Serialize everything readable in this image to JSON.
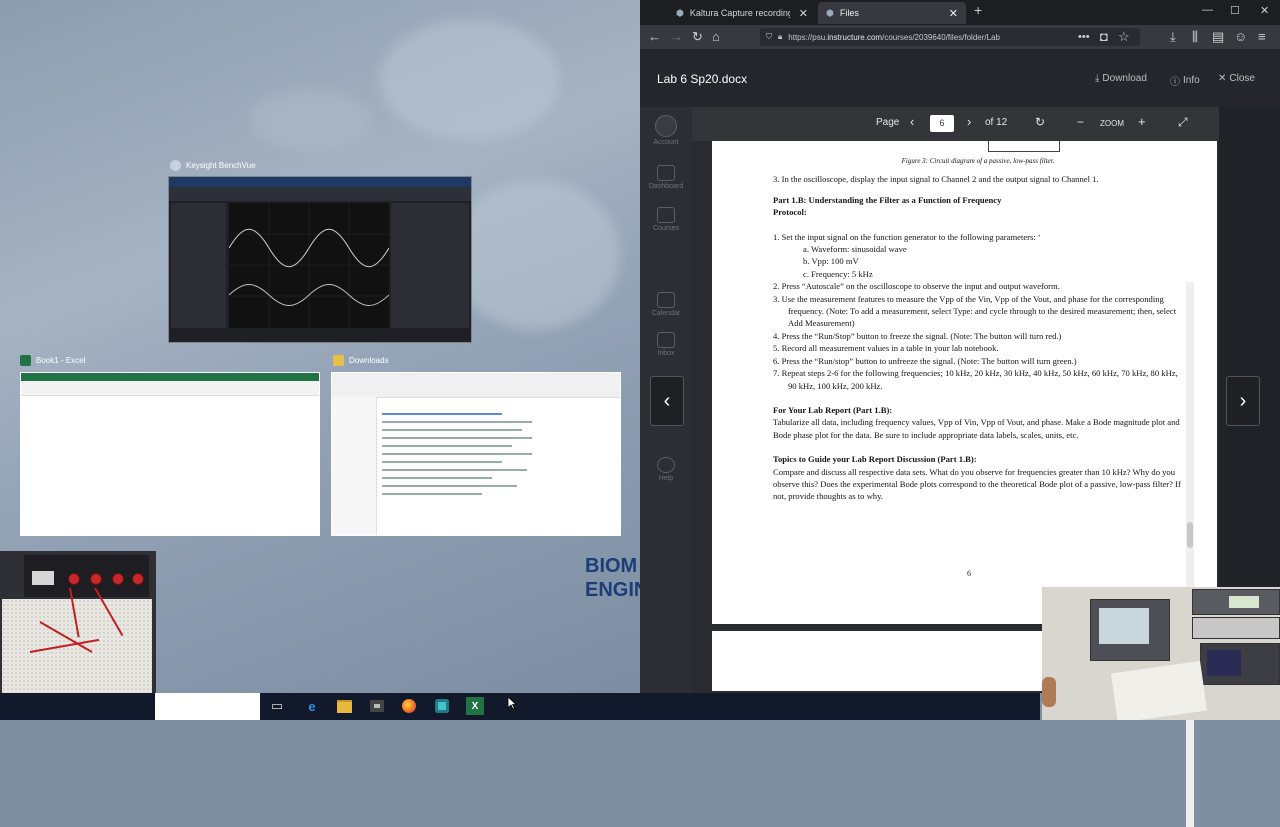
{
  "task_view": {
    "windows": [
      {
        "title": "Keysight BenchVue"
      },
      {
        "title": "Book1 - Excel"
      },
      {
        "title": "Downloads"
      }
    ],
    "wallpaper_text": [
      "BIOM",
      "ENGIN"
    ]
  },
  "browser": {
    "tabs": [
      {
        "label": "Kaltura Capture recording - Mo",
        "active": false
      },
      {
        "label": "Files",
        "active": true
      }
    ],
    "new_tab": "+",
    "window_controls": [
      "—",
      "☐",
      "✕"
    ],
    "url": {
      "prefix": "https://psu.",
      "host": "instructure.com",
      "path": "/courses/2039640/files/folder/Lab"
    }
  },
  "file_viewer": {
    "title": "Lab 6 Sp20.docx",
    "download_label": "Download",
    "info_label": "Info",
    "close_label": "Close",
    "page_label": "Page",
    "page_value": "6",
    "page_total": "of 12",
    "zoom_label": "ZOOM"
  },
  "document": {
    "caption": "Figure 3: Circuit diagram of a passive, low-pass filter.",
    "step3": "3.   In the oscilloscope, display the input signal to Channel 2 and the output signal to Channel 1.",
    "heading1": "Part 1.B: Understanding the Filter as a Function of Frequency",
    "heading1b": "Protocol:",
    "items": [
      "1.   Set the input signal on the function generator to the following parameters: ‘",
      "a.   Waveform: sinusoidal wave",
      "b.   Vpp: 100 mV",
      "c.   Frequency: 5 kHz",
      "2.   Press “Autoscale” on the oscilloscope to observe the input and output waveform.",
      "3.   Use the measurement features to measure the Vpp of the Vin, Vpp of the Vout, and phase for the corresponding frequency. (Note: To add a measurement, select Type: and cycle through to the desired measurement; then, select Add Measurement)",
      "4.   Press the “Run/Stop” button to freeze the signal. (Note: The button will turn red.)",
      "5.   Record all measurement values in a table in your lab notebook.",
      "6.   Press the “Run/stop” button to unfreeze the signal. (Note: The button will turn green.)",
      "7.   Repeat steps 2-6 for the following frequencies; 10 kHz, 20 kHz, 30 kHz, 40 kHz, 50 kHz, 60 kHz, 70 kHz, 80 kHz, 90 kHz, 100 kHz, 200 kHz."
    ],
    "heading2": "For Your Lab Report (Part 1.B):",
    "report": "Tabularize all data, including frequency values, Vpp of Vin, Vpp of Vout, and phase. Make a Bode magnitude plot and Bode phase plot for the data. Be sure to include appropriate data labels, scales, units, etc.",
    "heading3": "Topics to Guide your Lab Report Discussion (Part 1.B):",
    "discussion": "Compare and discuss all respective data sets. What do you observe for frequencies greater than 10 kHz? Why do you observe this? Does the experimental Bode plots correspond to the theoretical Bode plot of a passive, low-pass filter? If not, provide thoughts as to why.",
    "page_number": "6"
  },
  "canvas_nav": [
    "Account",
    "Dashboard",
    "Courses",
    "Calendar",
    "Inbox",
    "Help"
  ],
  "colors": {
    "excel_green": "#217346",
    "taskbar": "#12192a",
    "browser_bg": "#232428"
  }
}
